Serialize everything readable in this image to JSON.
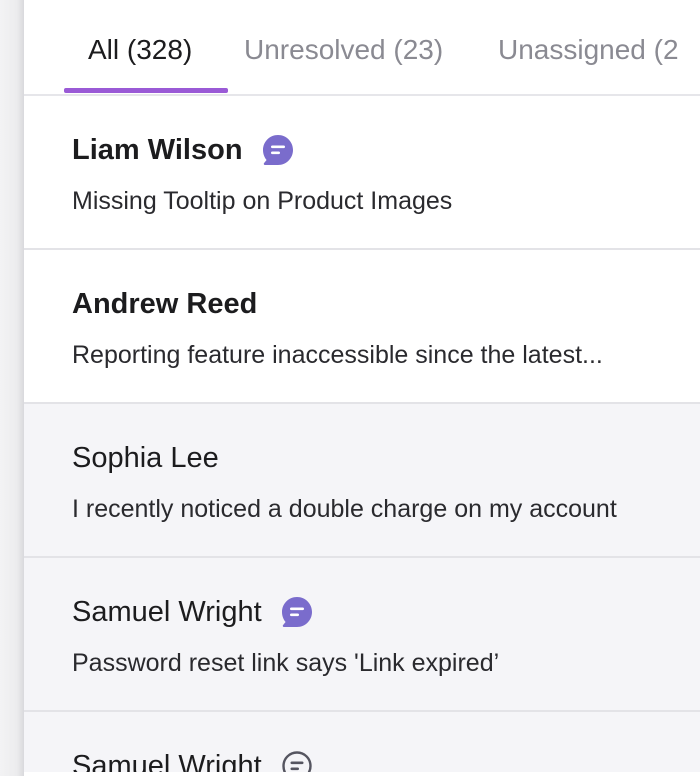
{
  "tabs": [
    {
      "label": "All (328)"
    },
    {
      "label": "Unresolved (23)"
    },
    {
      "label": "Unassigned (2"
    }
  ],
  "conversations": [
    {
      "name": "Liam Wilson",
      "preview": "Missing Tooltip on Product Images",
      "icon": "chat-bubble-filled-icon"
    },
    {
      "name": "Andrew Reed",
      "preview": "Reporting feature inaccessible since the latest..."
    },
    {
      "name": "Sophia Lee",
      "preview": "I recently noticed a double charge on my account"
    },
    {
      "name": "Samuel Wright",
      "preview": "Password reset link says 'Link expired’",
      "icon": "chat-bubble-filled-icon"
    },
    {
      "name": "Samuel Wright",
      "icon": "chat-bubble-outline-icon"
    }
  ],
  "colors": {
    "accent": "#9a5ad6",
    "icon_fill": "#7a6ccc",
    "read_row_bg": "#f5f5f8"
  }
}
